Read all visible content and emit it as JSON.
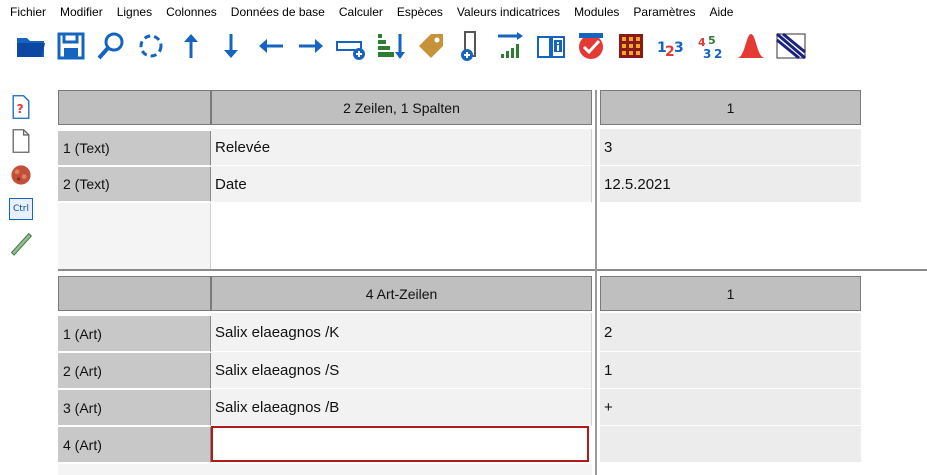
{
  "menu": [
    "Fichier",
    "Modifier",
    "Lignes",
    "Colonnes",
    "Données de base",
    "Calculer",
    "Espèces",
    "Valeurs indicatrices",
    "Modules",
    "Paramètres",
    "Aide"
  ],
  "header_table": {
    "title": "2 Zeilen, 1 Spalten",
    "col_header": "1",
    "rows": [
      {
        "label": "1 (Text)",
        "name": "Relevée",
        "value": "3"
      },
      {
        "label": "2 (Text)",
        "name": "Date",
        "value": "12.5.2021"
      }
    ]
  },
  "species_table": {
    "title": "4 Art-Zeilen",
    "col_header": "1",
    "rows": [
      {
        "label": "1 (Art)",
        "name": "Salix elaeagnos /K",
        "value": "2"
      },
      {
        "label": "2 (Art)",
        "name": "Salix elaeagnos /S",
        "value": "1"
      },
      {
        "label": "3 (Art)",
        "name": "Salix elaeagnos /B",
        "value": "+"
      },
      {
        "label": "4 (Art)",
        "name": "",
        "value": ""
      }
    ]
  },
  "side_tools": {
    "ctrl_label": "Ctrl"
  },
  "toolbar_icons": [
    "open-folder-icon",
    "save-icon",
    "search-icon",
    "rotate-icon",
    "arrow-up-icon",
    "arrow-down-icon",
    "arrow-left-icon",
    "arrow-right-icon",
    "add-row-icon",
    "sort-icon",
    "tag-icon",
    "add-column-icon",
    "bar-chart-icon",
    "info-book-icon",
    "check-icon",
    "grid-icon",
    "numbering-icon",
    "renumber-icon",
    "distribution-curve-icon",
    "pattern-icon"
  ]
}
